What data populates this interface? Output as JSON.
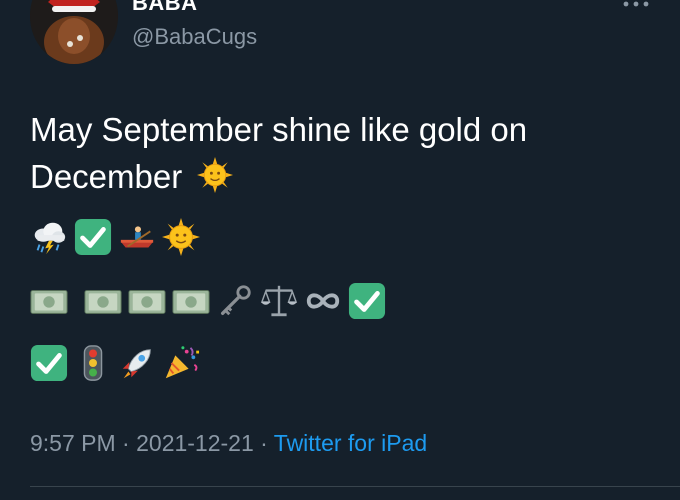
{
  "author": {
    "display_name": "BABA",
    "handle": "@BabaCugs"
  },
  "tweet": {
    "text_line1": "May September shine like gold on",
    "text_line2": "December",
    "emoji_rows": [
      [
        "cloud-with-lightning-and-rain",
        "check-mark-button",
        "person-rowing-boat",
        "sun-with-face"
      ],
      [
        "euro-banknote",
        "dollar-banknote",
        "yen-banknote",
        "pound-banknote",
        "old-key",
        "balance-scale",
        "infinity",
        "check-mark-button"
      ],
      [
        "check-mark-button",
        "vertical-traffic-light",
        "rocket",
        "party-popper"
      ]
    ]
  },
  "meta": {
    "time": "9:57 PM",
    "separator": " · ",
    "date": "2021-12-21",
    "source": "Twitter for iPad"
  },
  "colors": {
    "background": "#15202b",
    "text_primary": "#ffffff",
    "text_secondary": "#8b98a5",
    "link": "#1d9bf0",
    "check_green": "#3fb37f"
  }
}
